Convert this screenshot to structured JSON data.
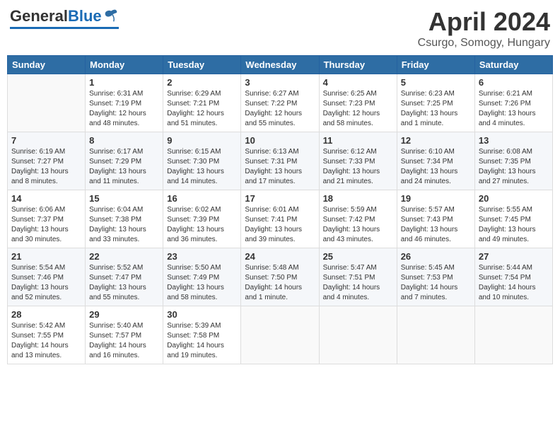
{
  "logo": {
    "general": "General",
    "blue": "Blue"
  },
  "header": {
    "month_title": "April 2024",
    "location": "Csurgo, Somogy, Hungary"
  },
  "weekdays": [
    "Sunday",
    "Monday",
    "Tuesday",
    "Wednesday",
    "Thursday",
    "Friday",
    "Saturday"
  ],
  "weeks": [
    [
      {
        "day": "",
        "info": ""
      },
      {
        "day": "1",
        "info": "Sunrise: 6:31 AM\nSunset: 7:19 PM\nDaylight: 12 hours\nand 48 minutes."
      },
      {
        "day": "2",
        "info": "Sunrise: 6:29 AM\nSunset: 7:21 PM\nDaylight: 12 hours\nand 51 minutes."
      },
      {
        "day": "3",
        "info": "Sunrise: 6:27 AM\nSunset: 7:22 PM\nDaylight: 12 hours\nand 55 minutes."
      },
      {
        "day": "4",
        "info": "Sunrise: 6:25 AM\nSunset: 7:23 PM\nDaylight: 12 hours\nand 58 minutes."
      },
      {
        "day": "5",
        "info": "Sunrise: 6:23 AM\nSunset: 7:25 PM\nDaylight: 13 hours\nand 1 minute."
      },
      {
        "day": "6",
        "info": "Sunrise: 6:21 AM\nSunset: 7:26 PM\nDaylight: 13 hours\nand 4 minutes."
      }
    ],
    [
      {
        "day": "7",
        "info": "Sunrise: 6:19 AM\nSunset: 7:27 PM\nDaylight: 13 hours\nand 8 minutes."
      },
      {
        "day": "8",
        "info": "Sunrise: 6:17 AM\nSunset: 7:29 PM\nDaylight: 13 hours\nand 11 minutes."
      },
      {
        "day": "9",
        "info": "Sunrise: 6:15 AM\nSunset: 7:30 PM\nDaylight: 13 hours\nand 14 minutes."
      },
      {
        "day": "10",
        "info": "Sunrise: 6:13 AM\nSunset: 7:31 PM\nDaylight: 13 hours\nand 17 minutes."
      },
      {
        "day": "11",
        "info": "Sunrise: 6:12 AM\nSunset: 7:33 PM\nDaylight: 13 hours\nand 21 minutes."
      },
      {
        "day": "12",
        "info": "Sunrise: 6:10 AM\nSunset: 7:34 PM\nDaylight: 13 hours\nand 24 minutes."
      },
      {
        "day": "13",
        "info": "Sunrise: 6:08 AM\nSunset: 7:35 PM\nDaylight: 13 hours\nand 27 minutes."
      }
    ],
    [
      {
        "day": "14",
        "info": "Sunrise: 6:06 AM\nSunset: 7:37 PM\nDaylight: 13 hours\nand 30 minutes."
      },
      {
        "day": "15",
        "info": "Sunrise: 6:04 AM\nSunset: 7:38 PM\nDaylight: 13 hours\nand 33 minutes."
      },
      {
        "day": "16",
        "info": "Sunrise: 6:02 AM\nSunset: 7:39 PM\nDaylight: 13 hours\nand 36 minutes."
      },
      {
        "day": "17",
        "info": "Sunrise: 6:01 AM\nSunset: 7:41 PM\nDaylight: 13 hours\nand 39 minutes."
      },
      {
        "day": "18",
        "info": "Sunrise: 5:59 AM\nSunset: 7:42 PM\nDaylight: 13 hours\nand 43 minutes."
      },
      {
        "day": "19",
        "info": "Sunrise: 5:57 AM\nSunset: 7:43 PM\nDaylight: 13 hours\nand 46 minutes."
      },
      {
        "day": "20",
        "info": "Sunrise: 5:55 AM\nSunset: 7:45 PM\nDaylight: 13 hours\nand 49 minutes."
      }
    ],
    [
      {
        "day": "21",
        "info": "Sunrise: 5:54 AM\nSunset: 7:46 PM\nDaylight: 13 hours\nand 52 minutes."
      },
      {
        "day": "22",
        "info": "Sunrise: 5:52 AM\nSunset: 7:47 PM\nDaylight: 13 hours\nand 55 minutes."
      },
      {
        "day": "23",
        "info": "Sunrise: 5:50 AM\nSunset: 7:49 PM\nDaylight: 13 hours\nand 58 minutes."
      },
      {
        "day": "24",
        "info": "Sunrise: 5:48 AM\nSunset: 7:50 PM\nDaylight: 14 hours\nand 1 minute."
      },
      {
        "day": "25",
        "info": "Sunrise: 5:47 AM\nSunset: 7:51 PM\nDaylight: 14 hours\nand 4 minutes."
      },
      {
        "day": "26",
        "info": "Sunrise: 5:45 AM\nSunset: 7:53 PM\nDaylight: 14 hours\nand 7 minutes."
      },
      {
        "day": "27",
        "info": "Sunrise: 5:44 AM\nSunset: 7:54 PM\nDaylight: 14 hours\nand 10 minutes."
      }
    ],
    [
      {
        "day": "28",
        "info": "Sunrise: 5:42 AM\nSunset: 7:55 PM\nDaylight: 14 hours\nand 13 minutes."
      },
      {
        "day": "29",
        "info": "Sunrise: 5:40 AM\nSunset: 7:57 PM\nDaylight: 14 hours\nand 16 minutes."
      },
      {
        "day": "30",
        "info": "Sunrise: 5:39 AM\nSunset: 7:58 PM\nDaylight: 14 hours\nand 19 minutes."
      },
      {
        "day": "",
        "info": ""
      },
      {
        "day": "",
        "info": ""
      },
      {
        "day": "",
        "info": ""
      },
      {
        "day": "",
        "info": ""
      }
    ]
  ]
}
